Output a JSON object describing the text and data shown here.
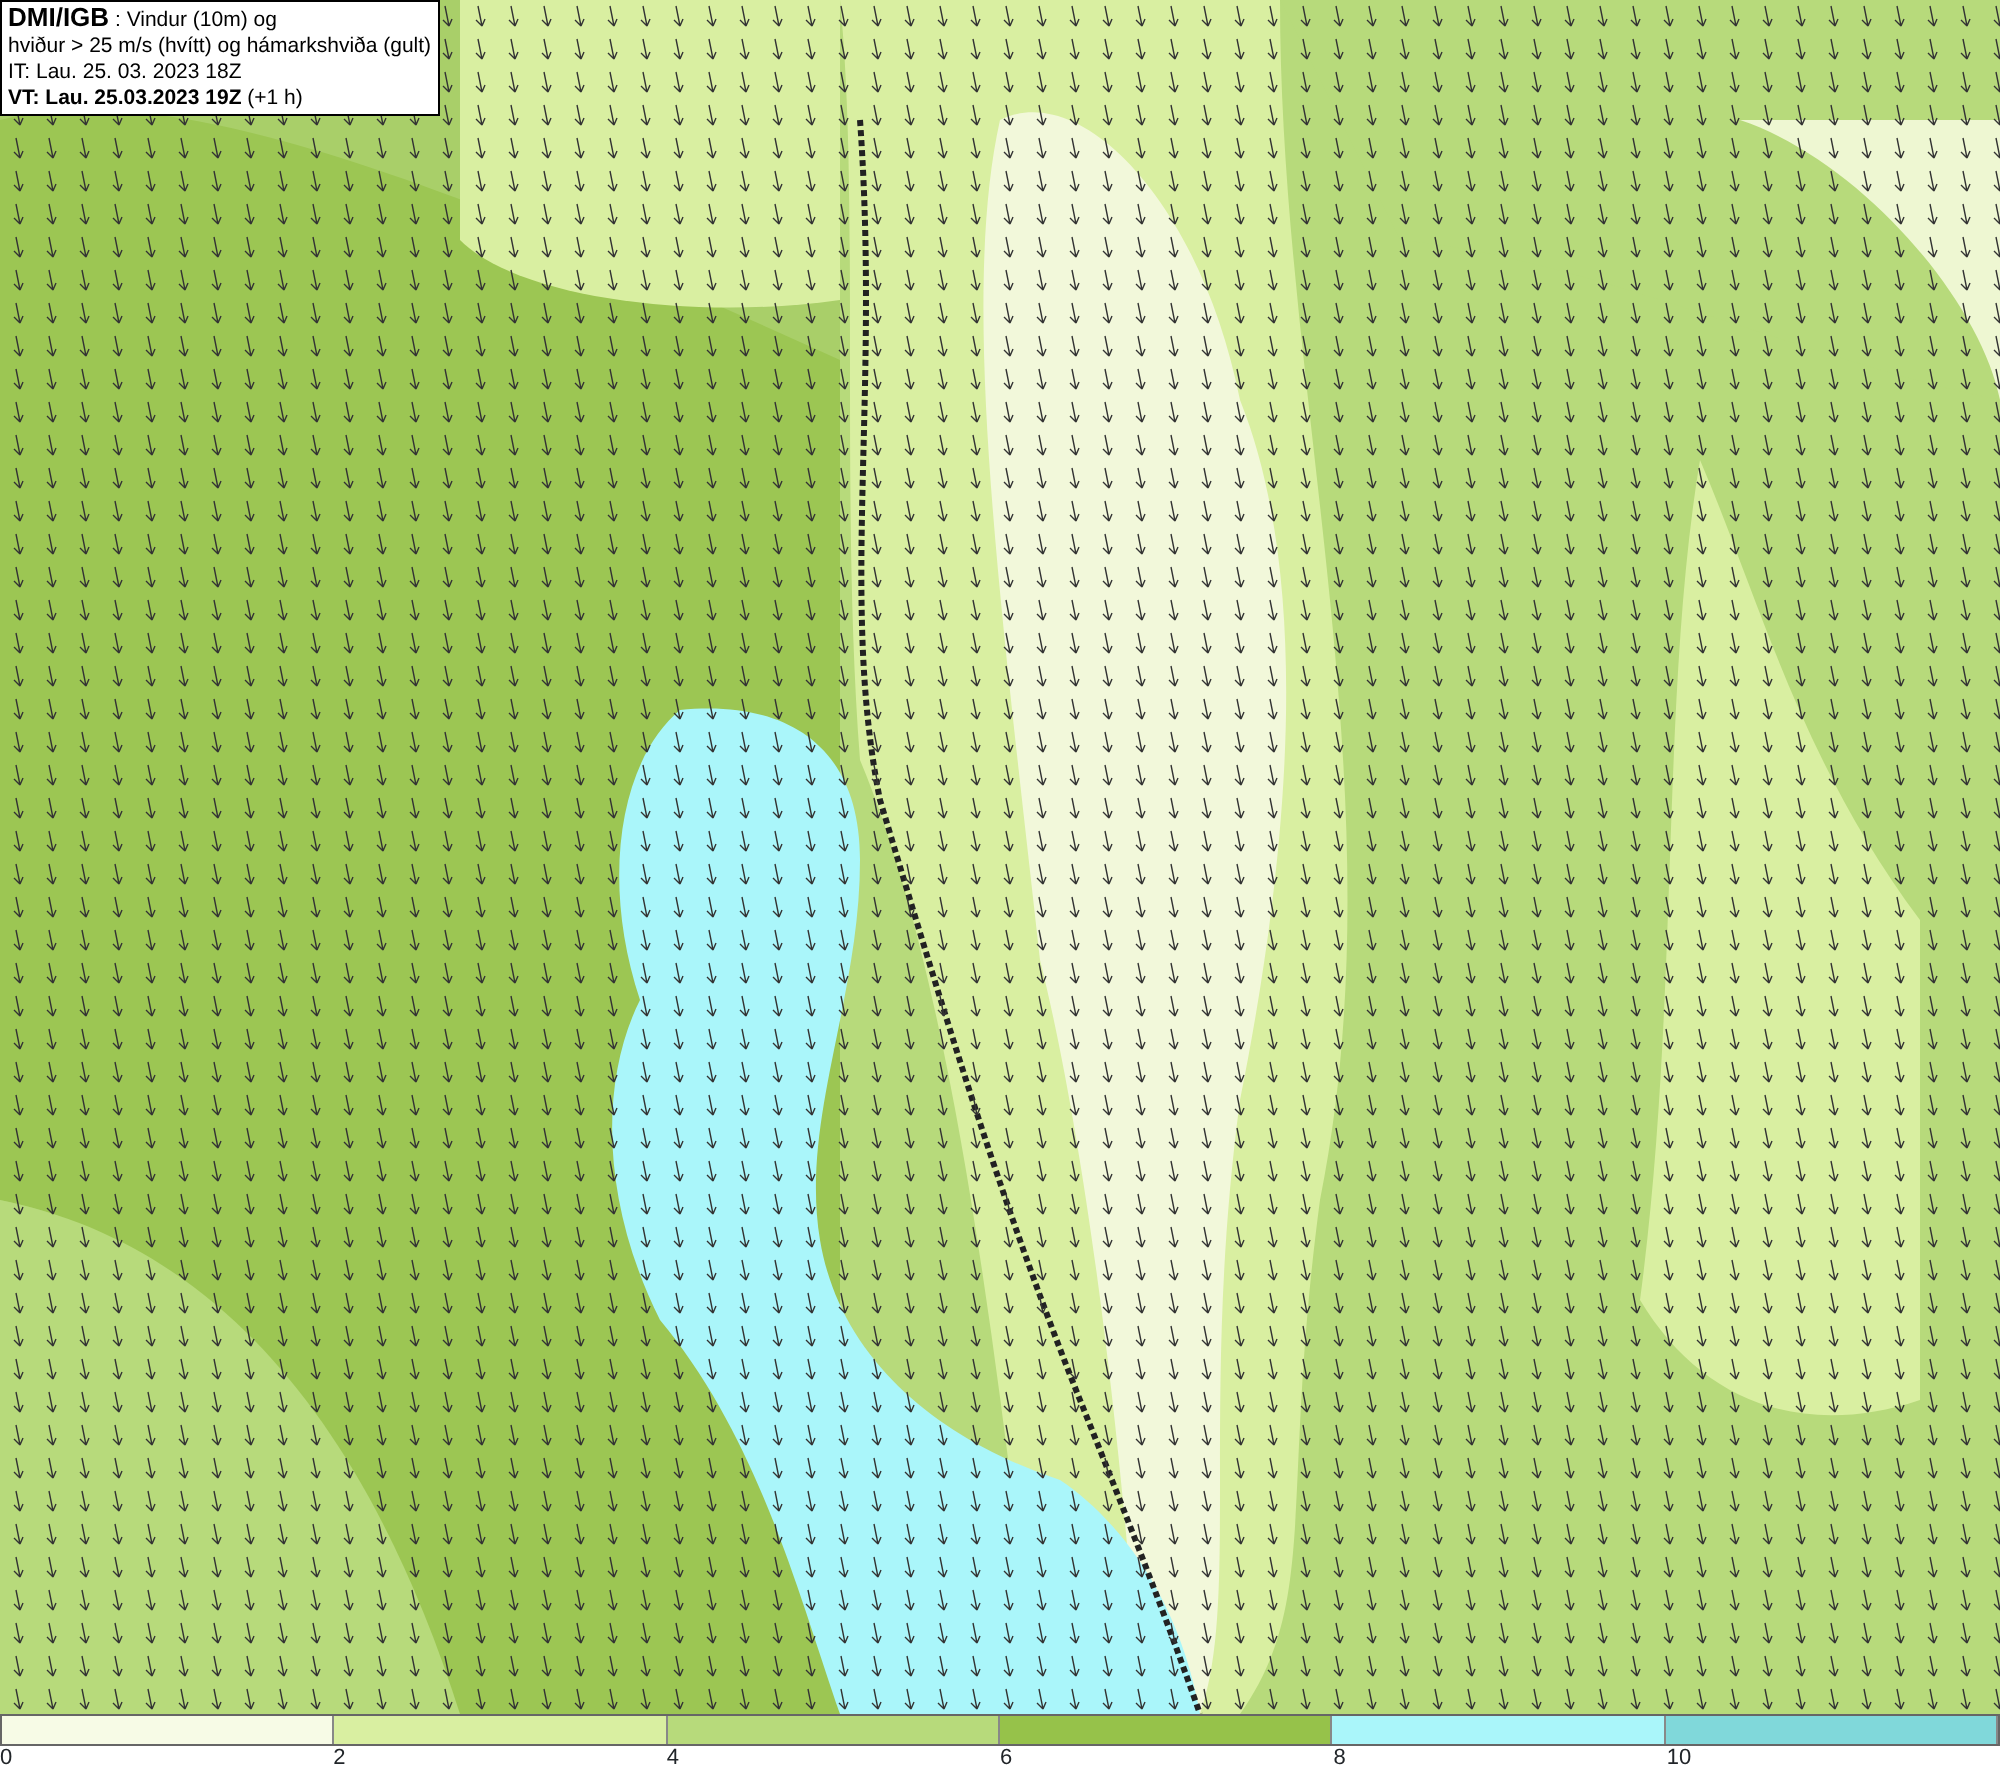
{
  "header": {
    "lines": [
      "**DMI/IGB** : Vindur (10m) og",
      "hviður > 25 m/s (hvítt) og hámarkshviða (gult)",
      "IT: Lau. 25. 03. 2023 18Z",
      "**VT: Lau. 25.03.2023 19Z** (+1 h)"
    ]
  },
  "legend": {
    "bins": [
      {
        "color": "#f7fbe6"
      },
      {
        "color": "#d9efa1"
      },
      {
        "color": "#b7da7b"
      },
      {
        "color": "#96c24a"
      },
      {
        "color": "#aaf6fa"
      },
      {
        "color": "#80d8da"
      }
    ],
    "labels": [
      "0",
      "2",
      "4",
      "6",
      "8",
      "10"
    ]
  }
}
